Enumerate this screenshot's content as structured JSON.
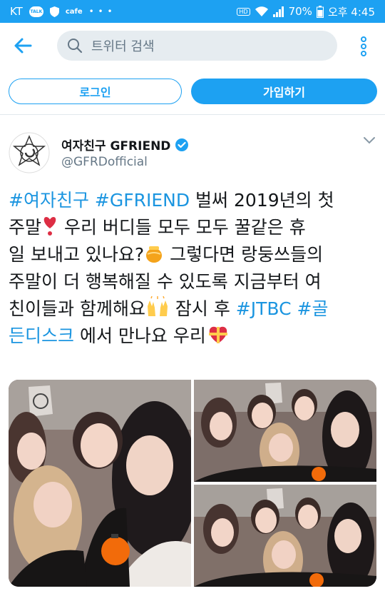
{
  "status_bar": {
    "carrier": "KT",
    "notif_talk": "TALK",
    "notif_cafe": "cafe",
    "more_dots": "• • •",
    "hd": "HD",
    "battery": "70%",
    "time": "오후 4:45"
  },
  "header": {
    "search_placeholder": "트위터 검색"
  },
  "auth": {
    "login_label": "로그인",
    "signup_label": "가입하기"
  },
  "tweet": {
    "author_name": "여자친구 GFRIEND",
    "author_handle": "@GFRDofficial",
    "line1": {
      "tag1": "#여자친구",
      "tag2": "#GFRIEND",
      "text": " 벌써 2019년의 첫"
    },
    "line2": {
      "text_a": "주말",
      "text_b": " 우리 버디들 모두 모두 꿀같은 휴"
    },
    "line3": {
      "text_a": "일 보내고 있나요?",
      "text_b": " 그렇다면 랑둥쓰들의"
    },
    "line4": {
      "text": "주말이 더 행복해질 수 있도록 지금부터 여"
    },
    "line5": {
      "text_a": "친이들과 함께해요",
      "text_b": " 잠시 후 ",
      "tag1": "#JTBC",
      "tag2": "#골"
    },
    "line6": {
      "tag": "든디스크",
      "text": " 에서 만나요 우리"
    }
  },
  "colors": {
    "accent": "#1da1f2",
    "hashtag": "#1b95e0",
    "secondary_text": "#657786",
    "search_bg": "#e6ecf0"
  },
  "icons": [
    "back-arrow-icon",
    "search-icon",
    "more-vertical-icon",
    "verified-badge-icon",
    "chevron-down-icon",
    "heart-exclamation-emoji",
    "honey-pot-emoji",
    "raised-hands-emoji",
    "heart-ribbon-emoji"
  ]
}
